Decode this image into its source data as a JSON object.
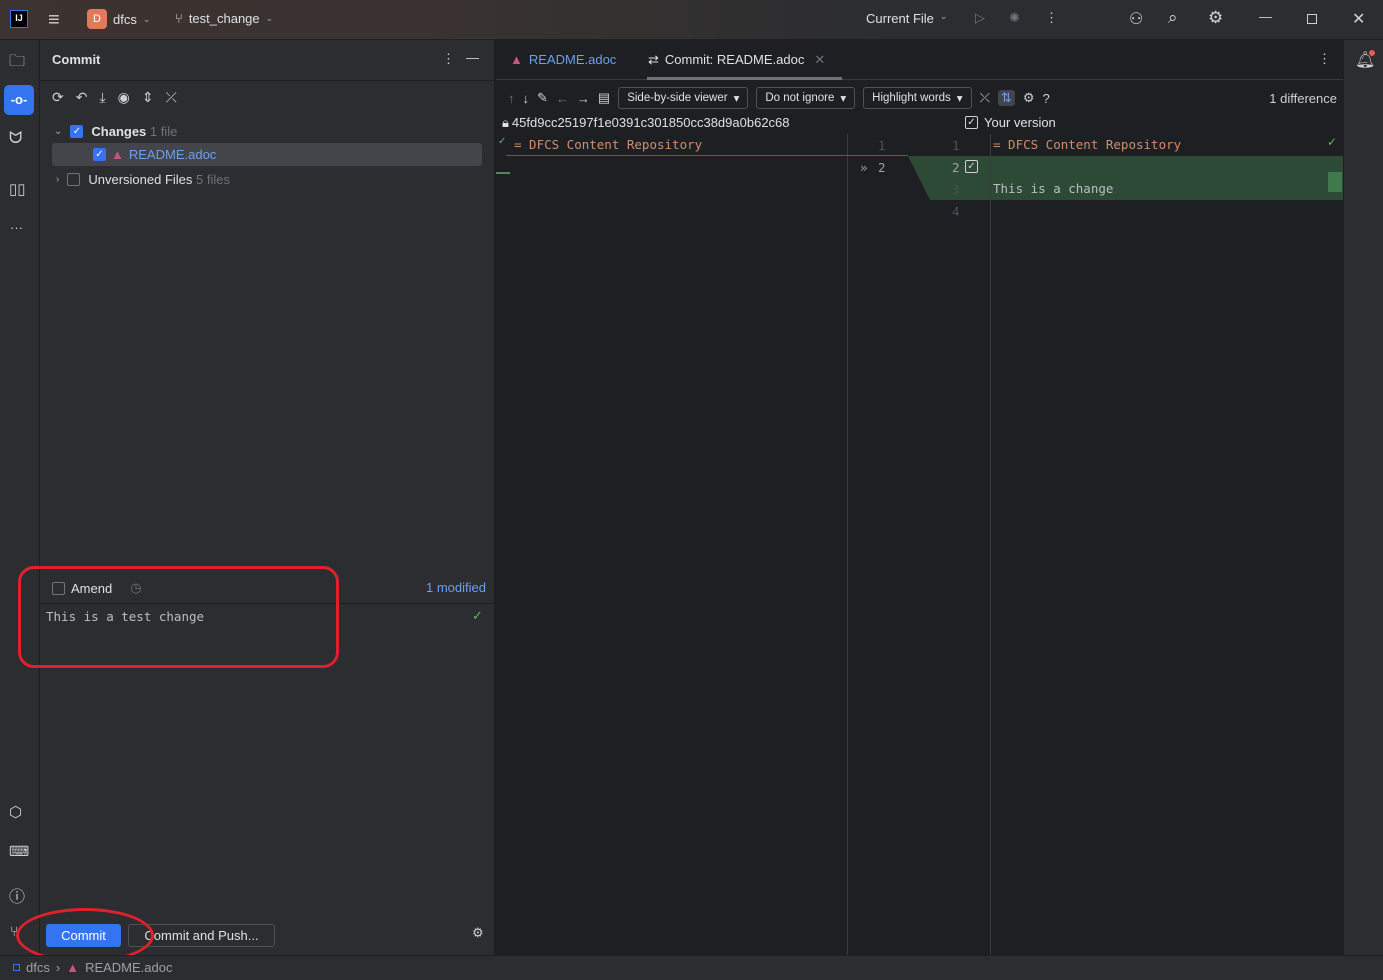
{
  "titlebar": {
    "project_letter": "D",
    "project": "dfcs",
    "branch": "test_change",
    "run_config": "Current File"
  },
  "commit_panel": {
    "title": "Commit",
    "tree": {
      "changes_label": "Changes",
      "changes_count": "1 file",
      "file": "README.adoc",
      "unversioned_label": "Unversioned Files",
      "unversioned_count": "5 files"
    },
    "amend_label": "Amend",
    "modified": "1 modified",
    "message": "This is a test change",
    "commit_button": "Commit",
    "commit_push_button": "Commit and Push..."
  },
  "tabs": [
    {
      "label": "README.adoc"
    },
    {
      "label": "Commit: README.adoc"
    }
  ],
  "diff": {
    "viewer": "Side-by-side viewer",
    "ignore": "Do not ignore",
    "highlight": "Highlight words",
    "count": "1 difference",
    "left_title": "45fd9cc25197f1e0391c301850cc38d9a0b62c68",
    "right_title": "Your version",
    "left_lines": [
      {
        "n": "1",
        "text": "= DFCS Content Repository"
      },
      {
        "n": "2",
        "text": ""
      }
    ],
    "right_lines": [
      {
        "n": "1",
        "text": "= DFCS Content Repository"
      },
      {
        "n": "2",
        "text": ""
      },
      {
        "n": "3",
        "text": "This is a change"
      },
      {
        "n": "4",
        "text": ""
      }
    ]
  },
  "statusbar": {
    "project": "dfcs",
    "file": "README.adoc"
  },
  "colors": {
    "accent": "#3574f0",
    "added": "#2c4a36",
    "annotation": "#e0202a"
  }
}
